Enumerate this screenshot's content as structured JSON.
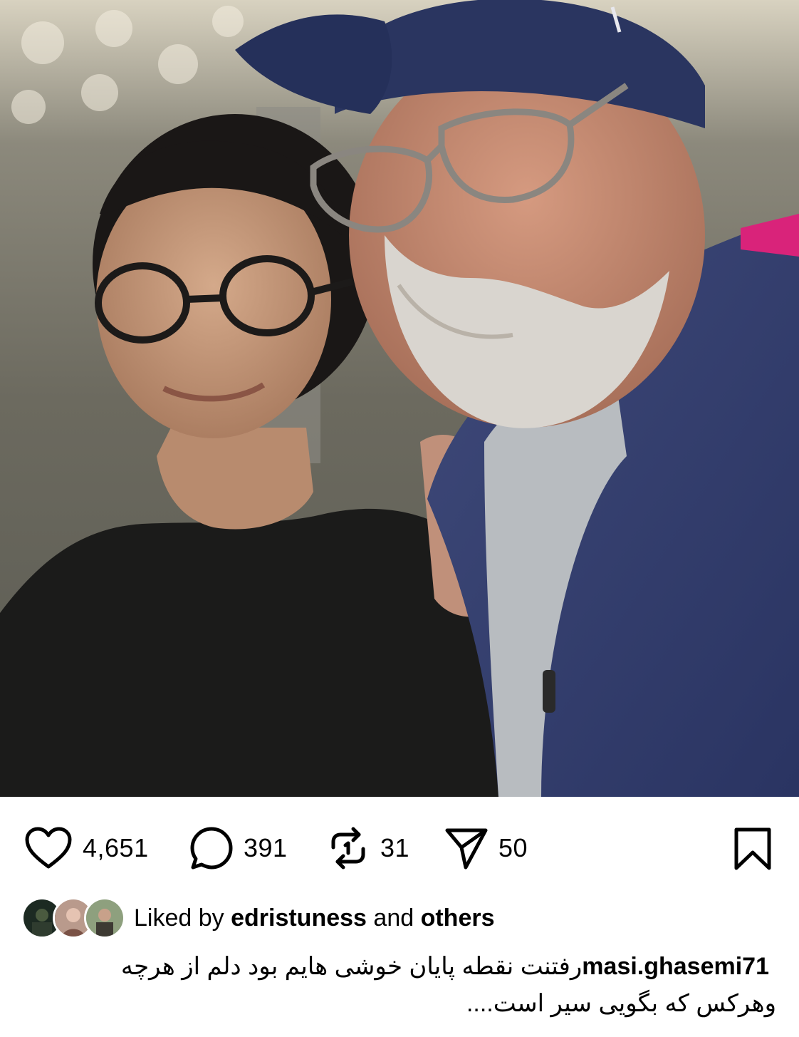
{
  "post": {
    "photo_alt": "photo",
    "likes_count": "4,651",
    "comments_count": "391",
    "reposts_count": "31",
    "shares_count": "50"
  },
  "liked_by": {
    "prefix": "Liked by",
    "user": "edristuness",
    "and": "and",
    "others": "others"
  },
  "caption": {
    "username": "masi.ghasemi71",
    "line1": "رفتنت نقطه پایان خوشی هایم بود دلم از هرچه",
    "line2": "وهرکس که بگویی سیر است...."
  },
  "colors": {
    "text": "#000000",
    "background": "#ffffff"
  },
  "icons": [
    "heart-icon",
    "comment-icon",
    "repost-icon",
    "share-icon",
    "bookmark-icon"
  ]
}
